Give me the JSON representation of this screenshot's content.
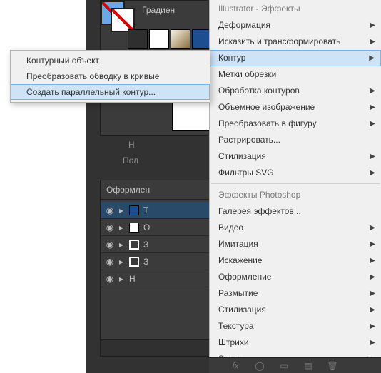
{
  "grad_panel": {
    "title": "Градиен"
  },
  "labels": {
    "h": "Н",
    "pol": "Пол"
  },
  "appearance": {
    "header": "Оформлен",
    "rows": [
      {
        "label": "Т",
        "swatch": "blue"
      },
      {
        "label": "О",
        "swatch": "white"
      },
      {
        "label": "З",
        "swatch": "stroke"
      },
      {
        "label": "З",
        "swatch": "stroke"
      },
      {
        "label": "Н",
        "swatch": null
      }
    ],
    "footer_fx": "fx"
  },
  "effects_menu": {
    "section_ai": "Illustrator - Эффекты",
    "ai_items": [
      {
        "label": "Деформация",
        "sub": true
      },
      {
        "label": "Исказить и трансформировать",
        "sub": true
      },
      {
        "label": "Контур",
        "sub": true,
        "highlight": true
      },
      {
        "label": "Метки обрезки",
        "sub": false
      },
      {
        "label": "Обработка контуров",
        "sub": true
      },
      {
        "label": "Объемное изображение",
        "sub": true
      },
      {
        "label": "Преобразовать в фигуру",
        "sub": true
      },
      {
        "label": "Растрировать...",
        "sub": false
      },
      {
        "label": "Стилизация",
        "sub": true
      },
      {
        "label": "Фильтры SVG",
        "sub": true
      }
    ],
    "section_ps": "Эффекты Photoshop",
    "ps_items": [
      {
        "label": "Галерея эффектов...",
        "sub": false
      },
      {
        "label": "Видео",
        "sub": true
      },
      {
        "label": "Имитация",
        "sub": true
      },
      {
        "label": "Искажение",
        "sub": true
      },
      {
        "label": "Оформление",
        "sub": true
      },
      {
        "label": "Размытие",
        "sub": true
      },
      {
        "label": "Стилизация",
        "sub": true
      },
      {
        "label": "Текстура",
        "sub": true
      },
      {
        "label": "Штрихи",
        "sub": true
      },
      {
        "label": "Эскиз",
        "sub": true
      }
    ]
  },
  "kontur_submenu": {
    "items": [
      {
        "label": "Контурный объект"
      },
      {
        "label": "Преобразовать обводку в кривые"
      },
      {
        "label": "Создать параллельный контур...",
        "highlight": true
      }
    ]
  },
  "icon_strip": {
    "fx": "fx"
  }
}
